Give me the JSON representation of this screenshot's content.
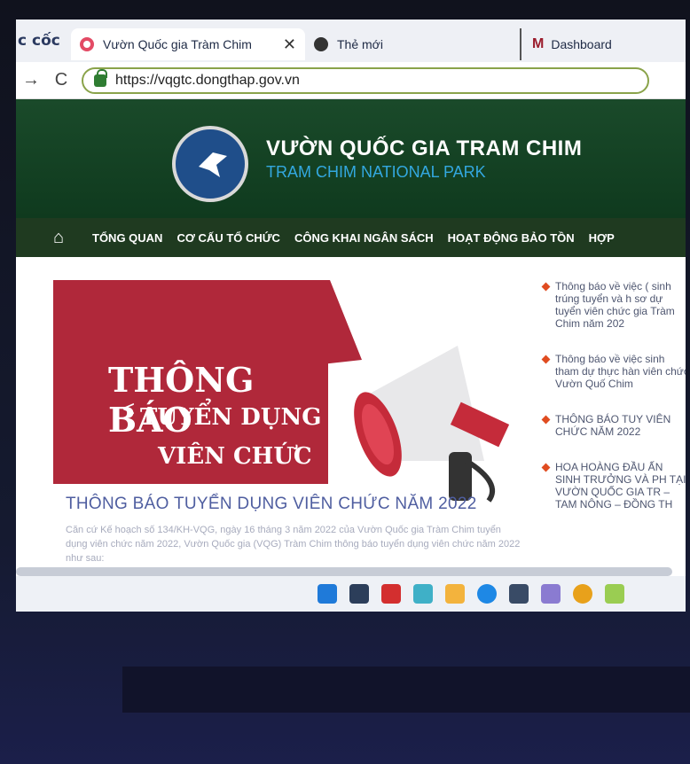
{
  "browser": {
    "brand": "c cốc",
    "tabs": [
      {
        "label": "Vườn Quốc gia Tràm Chim",
        "active": true
      },
      {
        "label": "Thẻ mới",
        "active": false
      },
      {
        "label": "Dashboard",
        "active": false
      }
    ],
    "close_symbol": "✕",
    "url": "https://vqgtc.dongthap.gov.vn"
  },
  "site": {
    "title_vi": "VƯỜN QUỐC GIA TRAM CHIM",
    "title_en": "TRAM CHIM NATIONAL PARK",
    "menu": [
      "TỔNG QUAN",
      "CƠ CẤU TỔ CHỨC",
      "CÔNG KHAI NGÂN SÁCH",
      "HOẠT ĐỘNG BẢO TỒN",
      "HỢP"
    ]
  },
  "banner": {
    "line1": "THÔNG BÁO",
    "line2": "TUYỂN DỤNG",
    "line3": "VIÊN CHỨC",
    "arrow": "<"
  },
  "news": {
    "title": "THÔNG BÁO TUYỂN DỤNG VIÊN CHỨC NĂM 2022",
    "snippet": "Căn cứ Kế hoạch số 134/KH-VQG, ngày 16 tháng 3 năm 2022 của Vườn Quốc gia Tràm Chim tuyển dụng viên chức năm 2022, Vườn Quốc gia (VQG) Tràm Chim thông báo tuyển dụng viên chức năm 2022 như sau:"
  },
  "sidebar": {
    "items": [
      "Thông báo về việc ( sinh trúng tuyển và h sơ dự tuyển viên chức gia Tràm Chim năm 202",
      "Thông báo về việc sinh tham dự thực hàn viên chức Vườn Quố Chim",
      "THÔNG BÁO TUY VIÊN CHỨC NĂM 2022",
      "HOA HOÀNG ĐẦU ẤN SINH TRƯỞNG VÀ PH TẠI VƯỜN QUỐC GIA TR – TAM NÔNG – ĐỒNG TH"
    ]
  },
  "colors": {
    "header_green": "#1a4a2a",
    "menu_green": "#1f3a20",
    "banner_red": "#b0283a",
    "news_title_blue": "#4f5ea0"
  }
}
